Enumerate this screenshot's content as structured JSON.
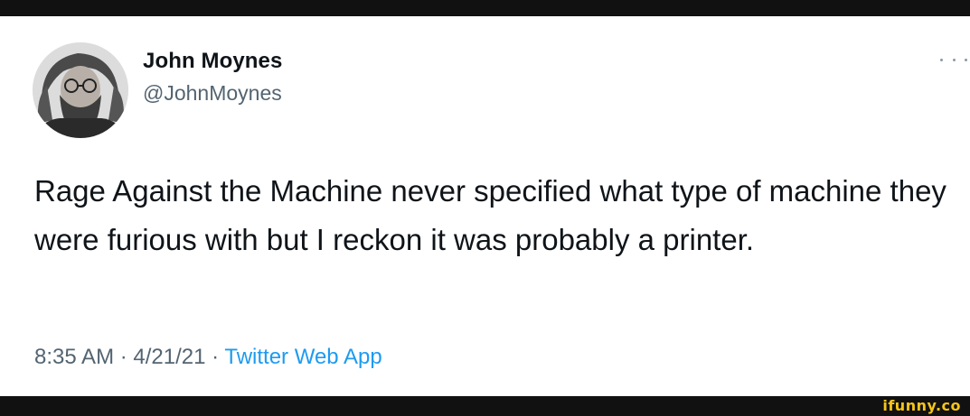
{
  "tweet": {
    "display_name": "John Moynes",
    "handle": "@JohnMoynes",
    "text": "Rage Against the Machine never specified what type of machine they were furious with but I reckon it was probably a printer.",
    "time": "8:35 AM",
    "separator": " · ",
    "date": "4/21/21",
    "source": "Twitter Web App"
  },
  "icons": {
    "more": "more-horizontal-icon",
    "avatar": "profile-photo"
  },
  "watermark": {
    "text": "ifunny.co"
  },
  "colors": {
    "text_primary": "#0f1419",
    "text_secondary": "#536471",
    "link": "#1d9bf0",
    "frame": "#111111",
    "watermark": "#f5c518"
  }
}
